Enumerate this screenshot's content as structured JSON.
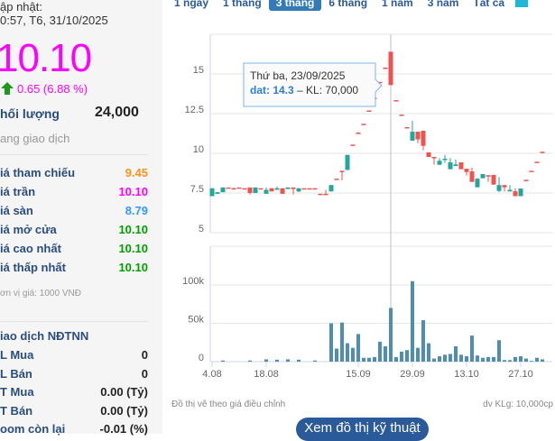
{
  "info": {
    "update_label": "ập nhật:",
    "update_time": "0:57, T6, 31/10/2025",
    "price": "10.10",
    "change": "0.65 (6.88 %)",
    "volume_label": "hối lượng",
    "volume_value": "24,000",
    "status": "ang giao dịch",
    "rows": [
      {
        "label": "iá tham chiếu",
        "value": "9.45",
        "color": "#f7941d"
      },
      {
        "label": "iá trần",
        "value": "10.10",
        "color": "#ff00ff"
      },
      {
        "label": "iá sàn",
        "value": "8.79",
        "color": "#3399ff"
      },
      {
        "label": "iá mở cửa",
        "value": "10.10",
        "color": "#00a000"
      },
      {
        "label": "iá cao nhất",
        "value": "10.10",
        "color": "#00a000"
      },
      {
        "label": "iá thấp nhất",
        "value": "10.10",
        "color": "#00a000"
      }
    ],
    "unit_note": "ơn vị giá: 1000 VNĐ",
    "foreign_title": "iao dịch NĐTNN",
    "foreign_rows": [
      {
        "label": "L Mua",
        "value": "0"
      },
      {
        "label": "L Bán",
        "value": "0"
      },
      {
        "label": "T Mua",
        "value": "0.00 (Tỷ)"
      },
      {
        "label": "T Bán",
        "value": "0.00 (Tỷ)"
      },
      {
        "label": "oom còn lại",
        "value": "-0.01 (%)"
      }
    ]
  },
  "ranges": [
    {
      "label": "1 ngày",
      "selected": false
    },
    {
      "label": "1 tháng",
      "selected": false
    },
    {
      "label": "3 tháng",
      "selected": true
    },
    {
      "label": "6 tháng",
      "selected": false
    },
    {
      "label": "1 năm",
      "selected": false
    },
    {
      "label": "3 năm",
      "selected": false
    },
    {
      "label": "Tất cả",
      "selected": false
    }
  ],
  "footer": {
    "note": "Đồ thị vẽ theo giá điều chỉnh",
    "unit": "dv KLg: 10,000cp",
    "button": "Xem đồ thị kỹ thuật"
  },
  "chart_data": {
    "type": "candlestick",
    "colors": {
      "up": "#26a69a",
      "down": "#ef5350",
      "volume": "#4f8db3"
    },
    "price_ticks": [
      "5",
      "7.5",
      "10",
      "12.5",
      "15"
    ],
    "price_tick_values": [
      5,
      7.5,
      10,
      12.5,
      15
    ],
    "volume_ticks": [
      "0",
      "50k",
      "100k"
    ],
    "volume_tick_values": [
      0,
      50,
      100
    ],
    "x_ticks": [
      {
        "label": "4.08",
        "index": 0
      },
      {
        "label": "18.08",
        "index": 10
      },
      {
        "label": "15.09",
        "index": 27
      },
      {
        "label": "29.09",
        "index": 37
      },
      {
        "label": "13.10",
        "index": 47
      },
      {
        "label": "27.10",
        "index": 57
      }
    ],
    "ohlc": [
      [
        7.3,
        7.8,
        7.3,
        7.8
      ],
      [
        7.45,
        7.55,
        7.45,
        7.55
      ],
      [
        7.55,
        7.85,
        7.55,
        7.85
      ],
      [
        7.85,
        7.85,
        7.85,
        7.85
      ],
      [
        7.8,
        7.85,
        7.8,
        7.8
      ],
      [
        7.85,
        7.85,
        7.85,
        7.85
      ],
      [
        7.8,
        7.8,
        7.8,
        7.8
      ],
      [
        7.85,
        7.85,
        7.4,
        7.5
      ],
      [
        7.5,
        7.85,
        7.5,
        7.85
      ],
      [
        7.8,
        7.8,
        7.8,
        7.8
      ],
      [
        7.45,
        7.85,
        7.45,
        7.7
      ],
      [
        7.8,
        7.8,
        7.6,
        7.6
      ],
      [
        7.7,
        7.9,
        7.7,
        7.8
      ],
      [
        7.8,
        7.8,
        7.45,
        7.45
      ],
      [
        7.75,
        7.85,
        7.75,
        7.85
      ],
      [
        7.85,
        7.85,
        7.4,
        7.75
      ],
      [
        7.6,
        7.8,
        7.55,
        7.8
      ],
      [
        7.8,
        7.8,
        7.8,
        7.8
      ],
      [
        7.8,
        7.8,
        7.8,
        7.8
      ],
      [
        7.8,
        7.8,
        7.8,
        7.8
      ],
      [
        7.45,
        7.45,
        7.45,
        7.45
      ],
      [
        7.45,
        7.7,
        7.45,
        7.45
      ],
      [
        7.6,
        8.0,
        7.6,
        8.0
      ],
      [
        8.4,
        8.4,
        8.4,
        8.4
      ],
      [
        8.9,
        8.9,
        8.3,
        8.9
      ],
      [
        8.95,
        9.9,
        8.95,
        9.9
      ],
      [
        10.55,
        10.55,
        10.55,
        10.55
      ],
      [
        11.3,
        11.35,
        11.25,
        11.3
      ],
      [
        11.86,
        11.86,
        11.86,
        11.86
      ],
      [
        12.7,
        12.7,
        12.7,
        12.7
      ],
      [
        13.5,
        13.5,
        13.5,
        13.5
      ],
      [
        14.5,
        14.5,
        14.5,
        14.5
      ],
      [
        15.4,
        15.4,
        15.4,
        15.4
      ],
      [
        16.4,
        16.4,
        14.3,
        14.3
      ],
      [
        13.35,
        13.35,
        13.35,
        13.35
      ],
      [
        12.44,
        12.44,
        12.44,
        12.44
      ],
      [
        11.65,
        11.65,
        11.65,
        11.65
      ],
      [
        10.8,
        12.05,
        10.8,
        11.36
      ],
      [
        11.36,
        11.36,
        10.64,
        10.88
      ],
      [
        11.42,
        11.42,
        10.19,
        10.47
      ],
      [
        10.06,
        10.06,
        9.77,
        9.77
      ],
      [
        9.77,
        9.77,
        9.28,
        9.77
      ],
      [
        9.28,
        9.7,
        9.28,
        9.53
      ],
      [
        9.6,
        9.9,
        9.4,
        9.66
      ],
      [
        9.0,
        9.7,
        9.0,
        9.43
      ],
      [
        9.2,
        9.6,
        9.2,
        9.3
      ],
      [
        9.43,
        9.43,
        9.0,
        9.0
      ],
      [
        9.03,
        9.03,
        8.6,
        8.82
      ],
      [
        8.86,
        9.1,
        8.2,
        8.2
      ],
      [
        7.86,
        8.45,
        7.86,
        8.4
      ],
      [
        8.43,
        8.69,
        8.43,
        8.69
      ],
      [
        8.62,
        8.62,
        8.2,
        8.62
      ],
      [
        8.64,
        8.64,
        8.03,
        8.03
      ],
      [
        7.63,
        8.5,
        7.55,
        8.0
      ],
      [
        8.0,
        8.0,
        7.6,
        7.86
      ],
      [
        7.6,
        8.0,
        7.6,
        7.7
      ],
      [
        7.61,
        7.8,
        7.3,
        7.3
      ],
      [
        7.3,
        7.78,
        7.3,
        7.78
      ],
      [
        8.33,
        8.33,
        8.33,
        8.33
      ],
      [
        8.9,
        8.9,
        8.9,
        8.9
      ],
      [
        9.47,
        9.47,
        9.47,
        9.47
      ],
      [
        10.1,
        10.1,
        10.1,
        10.1
      ]
    ],
    "volume_k": [
      0,
      0,
      1.5,
      0,
      0,
      0,
      0,
      1.5,
      0,
      0,
      3,
      0,
      2.5,
      0,
      3,
      0,
      2.5,
      0,
      0,
      1.5,
      0,
      0,
      50,
      17,
      51,
      24,
      18,
      36,
      5,
      5,
      6,
      26,
      20,
      70,
      6,
      13,
      15,
      105,
      18,
      54,
      24,
      4,
      7,
      9,
      10,
      20,
      9,
      7,
      34,
      8,
      5,
      6,
      6,
      28,
      2,
      2,
      6,
      7,
      4,
      1,
      5,
      3
    ],
    "tooltip": {
      "date": "Thứ ba, 23/09/2025",
      "series": "dat: 14.3",
      "sep": " – ",
      "volume": "KL: 70,000",
      "index": 33
    }
  }
}
